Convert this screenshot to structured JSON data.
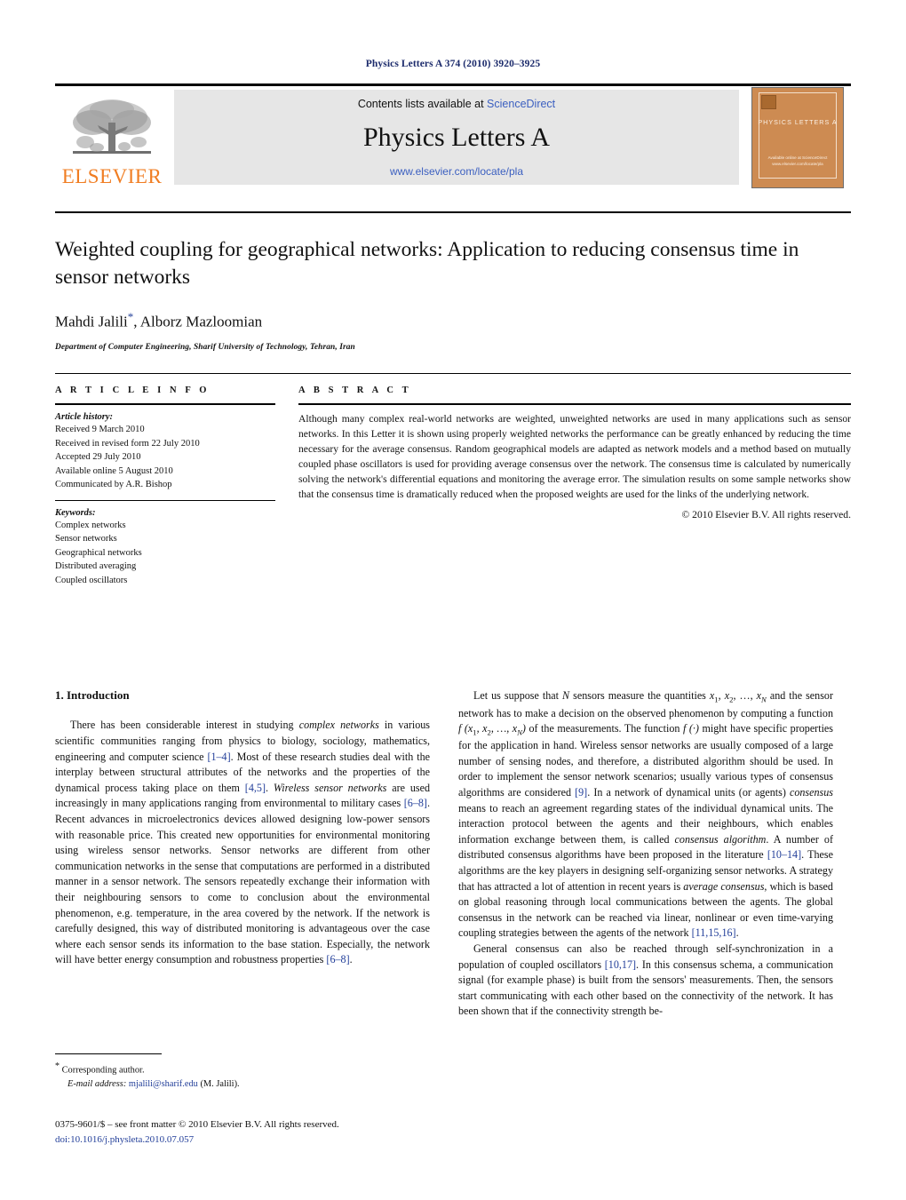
{
  "running_head": "Physics Letters A 374 (2010) 3920–3925",
  "masthead": {
    "publisher_wordmark": "ELSEVIER",
    "contents_prefix": "Contents lists available at",
    "contents_link": "ScienceDirect",
    "journal_name": "Physics Letters A",
    "journal_url": "www.elsevier.com/locate/pla",
    "cover_title": "PHYSICS LETTERS A",
    "cover_footer": "Available online at\nScienceDirect\nwww.elsevier.com/locate/pla",
    "accent_orange": "#f07d22",
    "link_blue": "#3b5fc0",
    "cover_bg": "#cd8b52"
  },
  "article": {
    "title": "Weighted coupling for geographical networks: Application to reducing consensus time in sensor networks",
    "authors": "Mahdi Jalili",
    "corresponding_marker": "*",
    "authors_rest": ", Alborz Mazloomian",
    "affiliation": "Department of Computer Engineering, Sharif University of Technology, Tehran, Iran"
  },
  "info": {
    "heading": "A R T I C L E    I N F O",
    "history_label": "Article history:",
    "history": [
      "Received 9 March 2010",
      "Received in revised form 22 July 2010",
      "Accepted 29 July 2010",
      "Available online 5 August 2010",
      "Communicated by A.R. Bishop"
    ],
    "keywords_label": "Keywords:",
    "keywords": [
      "Complex networks",
      "Sensor networks",
      "Geographical networks",
      "Distributed averaging",
      "Coupled oscillators"
    ]
  },
  "abstract": {
    "heading": "A B S T R A C T",
    "text": "Although many complex real-world networks are weighted, unweighted networks are used in many applications such as sensor networks. In this Letter it is shown using properly weighted networks the performance can be greatly enhanced by reducing the time necessary for the average consensus. Random geographical models are adapted as network models and a method based on mutually coupled phase oscillators is used for providing average consensus over the network. The consensus time is calculated by numerically solving the network's differential equations and monitoring the average error. The simulation results on some sample networks show that the consensus time is dramatically reduced when the proposed weights are used for the links of the underlying network.",
    "copyright": "© 2010 Elsevier B.V. All rights reserved."
  },
  "body": {
    "section_number_title": "1. Introduction",
    "left_paragraph_1": {
      "part1": "There has been considerable interest in studying ",
      "ital1": "complex networks",
      "part2": " in various scientific communities ranging from physics to biology, sociology, mathematics, engineering and computer science ",
      "cite1": "[1–4]",
      "part3": ". Most of these research studies deal with the interplay between structural attributes of the networks and the properties of the dynamical process taking place on them ",
      "cite2": "[4,5]",
      "part4": ". ",
      "ital2": "Wireless sensor networks",
      "part5": " are used increasingly in many applications ranging from environmental to military cases ",
      "cite3": "[6–8]",
      "part6": ". Recent advances in microelectronics devices allowed designing low-power sensors with reasonable price. This created new opportunities for environmental monitoring using wireless sensor networks. Sensor networks are different from other communication networks in the sense that computations are performed in a distributed manner in a sensor network. The sensors repeatedly exchange their information with their neighbouring sensors to come to conclusion about the environmental phenomenon, e.g. temperature, in the area covered by the network. If the network is carefully designed, this way of distributed monitoring is advantageous over the case where each sensor sends its information to the base station. Especially, the network will have better energy consumption and robustness properties ",
      "cite4": "[6–8]",
      "part7": "."
    },
    "right_paragraph_1": {
      "part1": "Let us suppose that ",
      "ital1": "N",
      "part2": " sensors measure the quantities ",
      "math1": "x",
      "sub1": "1",
      "math2": ", x",
      "sub2": "2",
      "part3": ", …, ",
      "math3": "x",
      "sub3": "N",
      "part4": " and the sensor network has to make a decision on the observed phenomenon by computing a function ",
      "math4": "f (x",
      "sub4": "1",
      "math5": ", x",
      "sub5": "2",
      "math6": ", …, x",
      "sub6": "N",
      "math7": ")",
      "part5": " of the measurements. The function ",
      "math8": "f (·)",
      "part6": " might have specific properties for the application in hand. Wireless sensor networks are usually composed of a large number of sensing nodes, and therefore, a distributed algorithm should be used. In order to implement the sensor network scenarios; usually various types of consensus algorithms are considered ",
      "cite1": "[9]",
      "part7": ". In a network of dynamical units (or agents) ",
      "ital2": "consensus",
      "part8": " means to reach an agreement regarding states of the individual dynamical units. The interaction protocol between the agents and their neighbours, which enables information exchange between them, is called ",
      "ital3": "consensus algorithm",
      "part9": ". A number of distributed consensus algorithms have been proposed in the literature ",
      "cite2": "[10–14]",
      "part10": ". These algorithms are the key players in designing self-organizing sensor networks. A strategy that has attracted a lot of attention in recent years is ",
      "ital4": "average consensus",
      "part11": ", which is based on global reasoning through local communications between the agents. The global consensus in the network can be reached via linear, nonlinear or even time-varying coupling strategies between the agents of the network ",
      "cite3": "[11,15,16]",
      "part12": "."
    },
    "right_paragraph_2": {
      "part1": "General consensus can also be reached through self-synchronization in a population of coupled oscillators ",
      "cite1": "[10,17]",
      "part2": ". In this consensus schema, a communication signal (for example phase) is built from the sensors' measurements. Then, the sensors start communicating with each other based on the connectivity of the network. It has been shown that if the connectivity strength be-"
    }
  },
  "footnotes": {
    "corresponding_marker": "*",
    "corresponding_text": "Corresponding author.",
    "email_label": "E-mail address:",
    "email": "mjalili@sharif.edu",
    "email_suffix": "(M. Jalili)."
  },
  "imprint": {
    "issn_line": "0375-9601/$ – see front matter © 2010 Elsevier B.V. All rights reserved.",
    "doi": "doi:10.1016/j.physleta.2010.07.057"
  }
}
